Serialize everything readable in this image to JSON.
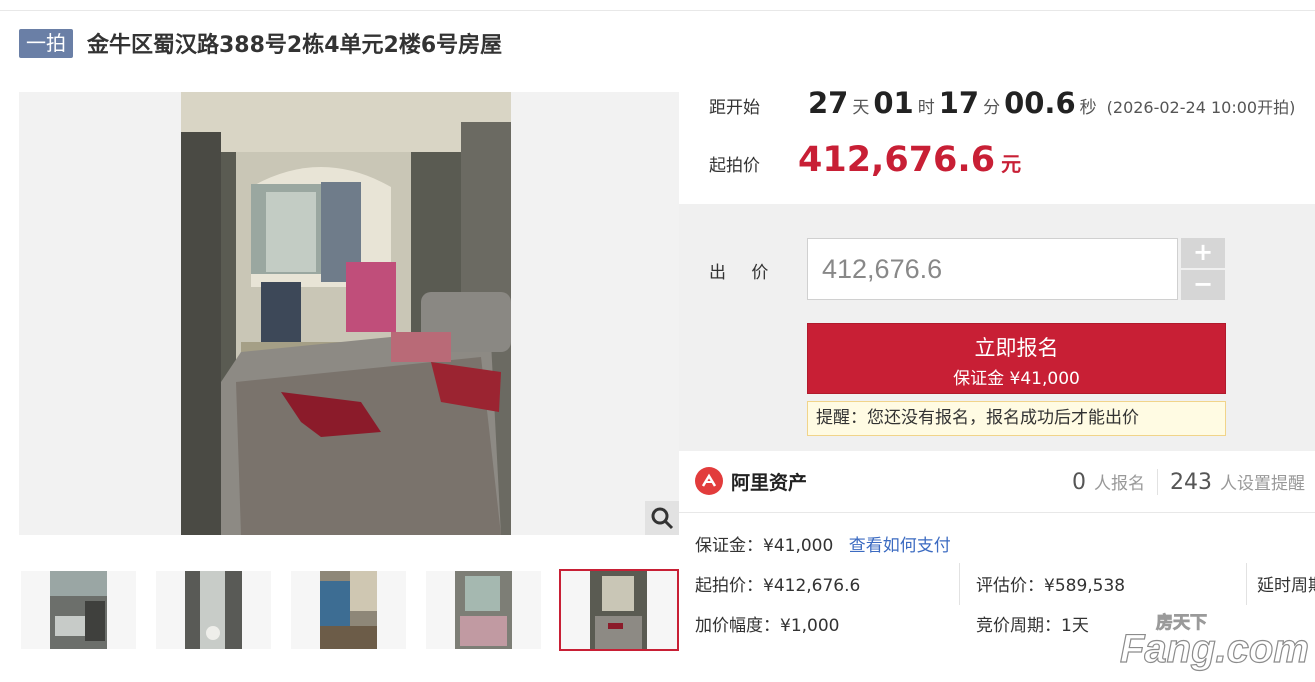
{
  "header": {
    "badge": "一拍",
    "title": "金牛区蜀汉路388号2栋4单元2楼6号房屋"
  },
  "gallery": {
    "thumb_count": 5,
    "selected_index": 4,
    "zoom_icon": "magnifier-icon"
  },
  "countdown": {
    "label": "距开始",
    "days": "27",
    "days_unit": "天",
    "hours": "01",
    "hours_unit": "时",
    "minutes": "17",
    "minutes_unit": "分",
    "seconds": "00.6",
    "seconds_unit": "秒",
    "start_time": "(2026-02-24 10:00开拍)"
  },
  "start_price": {
    "label": "起拍价",
    "value": "412,676.6",
    "unit": "元"
  },
  "bid": {
    "label": "出 价",
    "input_value": "412,676.6",
    "plus": "+",
    "minus": "−",
    "signup_label": "立即报名",
    "signup_deposit": "保证金 ¥41,000",
    "reminder": "提醒：您还没有报名，报名成功后才能出价"
  },
  "info": {
    "brand": "阿里资产",
    "signups_count": "0",
    "signups_label": "人报名",
    "reminders_count": "243",
    "reminders_label": "人设置提醒",
    "deposit": "保证金：¥41,000",
    "deposit_link": "查看如何支付",
    "start_price": "起拍价：¥412,676.6",
    "appraisal": "评估价：¥589,538",
    "extension": "延时周期",
    "increment": "加价幅度：¥1,000",
    "cycle": "竞价周期：1天"
  },
  "watermark": {
    "top": "房天下",
    "main": "Fang.com"
  },
  "colors": {
    "accent_red": "#c81f35",
    "badge_blue": "#6a7fa6",
    "link_blue": "#3c6bc1"
  }
}
